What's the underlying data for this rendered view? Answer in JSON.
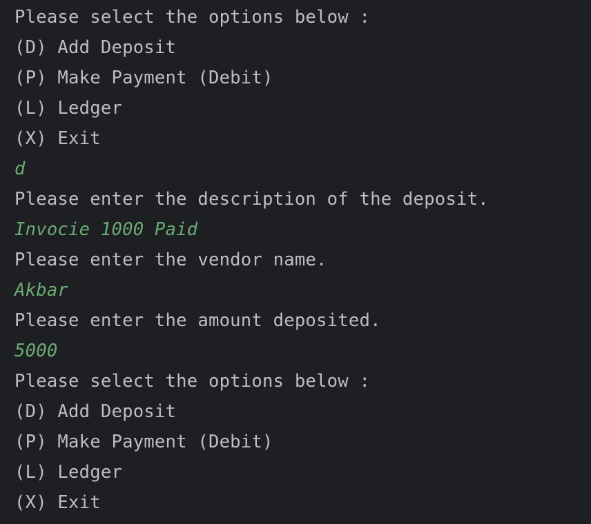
{
  "console": {
    "lines": [
      {
        "text": "Please select the options below :",
        "kind": "out"
      },
      {
        "text": "(D) Add Deposit",
        "kind": "out"
      },
      {
        "text": "(P) Make Payment (Debit)",
        "kind": "out"
      },
      {
        "text": "(L) Ledger",
        "kind": "out"
      },
      {
        "text": "(X) Exit",
        "kind": "out"
      },
      {
        "text": "d",
        "kind": "in"
      },
      {
        "text": "Please enter the description of the deposit.",
        "kind": "out"
      },
      {
        "text": "Invocie 1000 Paid",
        "kind": "in"
      },
      {
        "text": "Please enter the vendor name.",
        "kind": "out"
      },
      {
        "text": "Akbar",
        "kind": "in"
      },
      {
        "text": "Please enter the amount deposited.",
        "kind": "out"
      },
      {
        "text": "5000",
        "kind": "in"
      },
      {
        "text": "Please select the options below :",
        "kind": "out"
      },
      {
        "text": "(D) Add Deposit",
        "kind": "out"
      },
      {
        "text": "(P) Make Payment (Debit)",
        "kind": "out"
      },
      {
        "text": "(L) Ledger",
        "kind": "out"
      },
      {
        "text": "(X) Exit",
        "kind": "out"
      }
    ]
  },
  "colors": {
    "background": "#1e1f22",
    "output_text": "#bcbec4",
    "user_input_text": "#6aab73"
  }
}
